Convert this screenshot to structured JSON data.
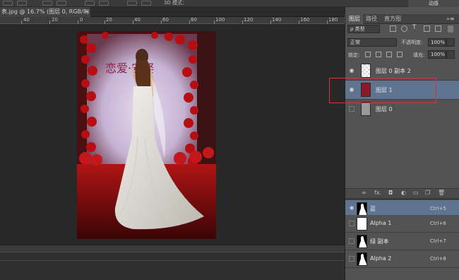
{
  "options_bar": {
    "text": "3D 模式：",
    "right_button": "动感"
  },
  "document": {
    "tab_title": "表.jpg @ 16.7% (图层 0, RGB/8) *",
    "close": "×"
  },
  "ruler": {
    "ticks": [
      "40",
      "20",
      "0",
      "20",
      "40",
      "60",
      "80",
      "100",
      "120",
      "140",
      "160",
      "180"
    ]
  },
  "photo": {
    "sign_text": "恋爱·安娶"
  },
  "panel": {
    "tabs": [
      "图层",
      "路径",
      "直方图"
    ],
    "menu_icon": "»≡",
    "filter_kind": "ρ 类型",
    "blend_mode": "正常",
    "opacity_label": "不透明度:",
    "opacity_value": "100%",
    "lock_label": "锁定:",
    "fill_label": "填充:",
    "fill_value": "100%",
    "filter_t": "T"
  },
  "layers": [
    {
      "name": "图层 0 副本 2",
      "visible": true,
      "selected": false
    },
    {
      "name": "图层 1",
      "visible": true,
      "selected": true
    },
    {
      "name": "图层 0",
      "visible": false,
      "selected": false
    }
  ],
  "layers_footer_icons": [
    "link-icon",
    "fx-icon",
    "mask-icon",
    "adjustment-icon",
    "folder-icon",
    "new-layer-icon",
    "trash-icon"
  ],
  "layers_footer_glyphs": [
    "∞",
    "fx.",
    "◘",
    "◐",
    "▭",
    "❐",
    "🗑"
  ],
  "channels": [
    {
      "name": "蓝",
      "shortcut": "Ctrl+5",
      "selected": true,
      "eye": "◉"
    },
    {
      "name": "Alpha 1",
      "shortcut": "Ctrl+6",
      "selected": false,
      "eye": ""
    },
    {
      "name": "绿 副本",
      "shortcut": "Ctrl+7",
      "selected": false,
      "eye": ""
    },
    {
      "name": "Alpha 2",
      "shortcut": "Ctrl+8",
      "selected": false,
      "eye": ""
    }
  ],
  "colors": {
    "selection": "#5e7490",
    "annotation": "#e2303a",
    "panel": "#535353",
    "canvas": "#282828"
  }
}
